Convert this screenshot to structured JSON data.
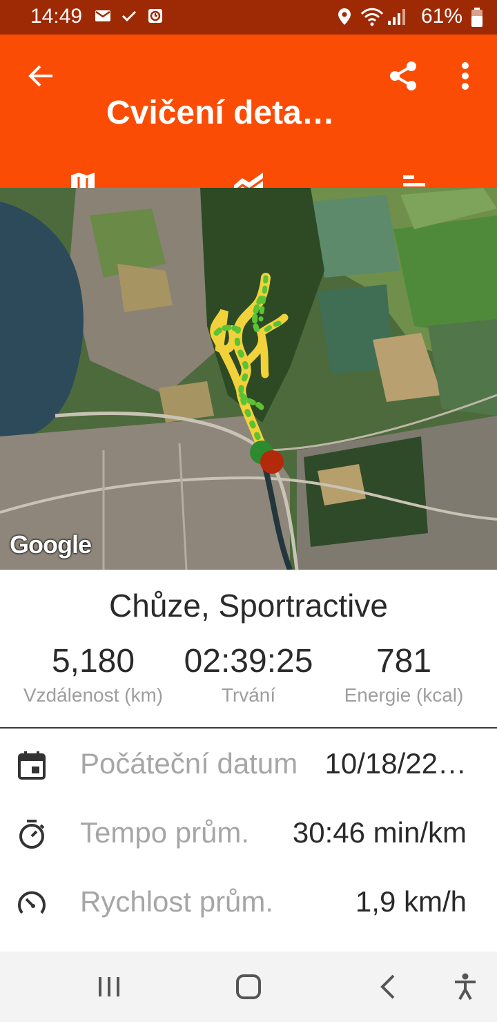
{
  "status": {
    "time": "14:49",
    "battery": "61%"
  },
  "appbar": {
    "title": "Cvičení deta…"
  },
  "icons": {
    "back": "arrow-left-icon",
    "share": "share-icon",
    "more": "more-vert-icon",
    "tab_map": "map-icon",
    "tab_chart": "area-chart-icon",
    "tab_laps": "bars-icon"
  },
  "map": {
    "attribution": "Google"
  },
  "activity": {
    "name": "Chůze, Sportractive"
  },
  "stats": [
    {
      "value": "5,180",
      "label": "Vzdálenost (km)"
    },
    {
      "value": "02:39:25",
      "label": "Trvání"
    },
    {
      "value": "781",
      "label": "Energie (kcal)"
    }
  ],
  "details": [
    {
      "label": "Počáteční datum",
      "value": "10/18/22…"
    },
    {
      "label": "Tempo prům.",
      "value": "30:46 min/km"
    },
    {
      "label": "Rychlost prům.",
      "value": "1,9 km/h"
    }
  ],
  "colors": {
    "statusbar": "#9e2a05",
    "appbar": "#fb4c06",
    "track": "#f2d23a",
    "track_alt": "#5cc234"
  }
}
